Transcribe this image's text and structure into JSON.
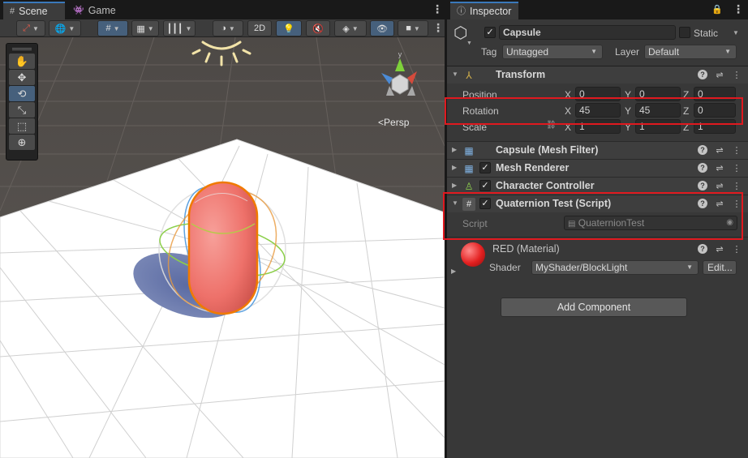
{
  "scene_tabs": [
    {
      "label": "Scene",
      "icon": "grid-icon",
      "active": true
    },
    {
      "label": "Game",
      "icon": "gamepad-icon",
      "active": false
    }
  ],
  "toolbar": {
    "button_2d": "2D"
  },
  "viewport": {
    "persp_label": "Persp",
    "axis_labels": {
      "y": "y",
      "x": "x",
      "z": "z"
    }
  },
  "inspector": {
    "tab_label": "Inspector",
    "object": {
      "name": "Capsule",
      "static_label": "Static",
      "tag_label": "Tag",
      "tag_value": "Untagged",
      "layer_label": "Layer",
      "layer_value": "Default"
    },
    "transform": {
      "title": "Transform",
      "position": {
        "label": "Position",
        "x": "0",
        "y": "0",
        "z": "0"
      },
      "rotation": {
        "label": "Rotation",
        "x": "45",
        "y": "45",
        "z": "0"
      },
      "scale": {
        "label": "Scale",
        "x": "1",
        "y": "1",
        "z": "1"
      },
      "axis_x": "X",
      "axis_y": "Y",
      "axis_z": "Z"
    },
    "components": {
      "mesh_filter": "Capsule (Mesh Filter)",
      "mesh_renderer": "Mesh Renderer",
      "character_controller": "Character Controller",
      "script_component": "Quaternion Test (Script)"
    },
    "script": {
      "label": "Script",
      "value": "QuaternionTest"
    },
    "material": {
      "name": "RED (Material)",
      "shader_label": "Shader",
      "shader_value": "MyShader/BlockLight",
      "edit_label": "Edit..."
    },
    "add_component": "Add Component"
  },
  "colors": {
    "highlight": "#e0191f",
    "active_tab_accent": "#3a79bb",
    "capsule": "#f07a72"
  }
}
